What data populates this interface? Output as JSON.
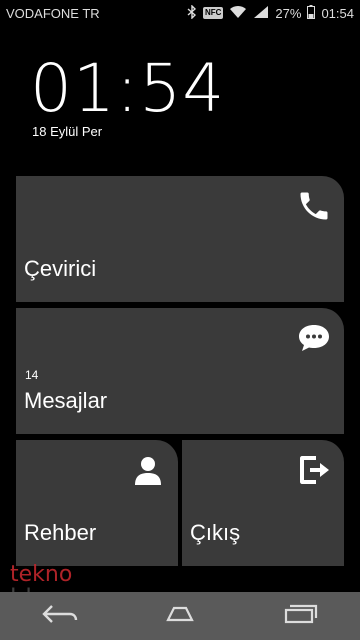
{
  "status_bar": {
    "carrier": "VODAFONE TR",
    "nfc": "NFC",
    "battery": "27%",
    "time": "01:54"
  },
  "lockscreen": {
    "clock": "01:54",
    "date": "18 Eylül Per"
  },
  "tiles": {
    "dialer": {
      "label": "Çevirici",
      "icon": "phone-icon"
    },
    "messages": {
      "label": "Mesajlar",
      "count": "14",
      "icon": "chat-bubble-icon"
    },
    "contacts": {
      "label": "Rehber",
      "icon": "person-icon"
    },
    "exit": {
      "label": "Çıkış",
      "icon": "exit-icon"
    }
  },
  "watermark": {
    "top": "tekno",
    "bottom": "blog"
  },
  "navbar": {
    "buttons": [
      "back-icon",
      "home-icon",
      "recent-apps-icon"
    ]
  },
  "colors": {
    "tile_bg": "#3a3a3a",
    "navbar_bg": "#5a5a5a",
    "watermark_red": "#c1272d"
  }
}
